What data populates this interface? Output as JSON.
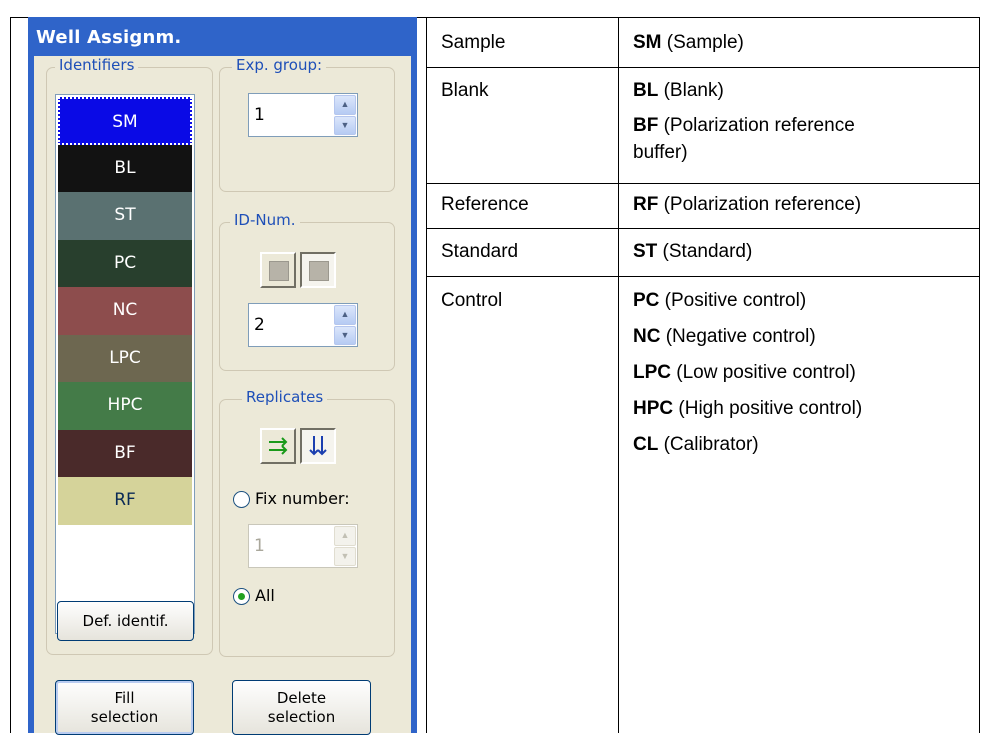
{
  "panel": {
    "title": "Well Assignm.",
    "identifiers": {
      "label": "Identifiers",
      "items": [
        {
          "code": "SM",
          "color": "#0a0ae6",
          "selected": true
        },
        {
          "code": "BL",
          "color": "#121212"
        },
        {
          "code": "ST",
          "color": "#5a7171"
        },
        {
          "code": "PC",
          "color": "#283f2d"
        },
        {
          "code": "NC",
          "color": "#8d4d4d"
        },
        {
          "code": "LPC",
          "color": "#6d6750"
        },
        {
          "code": "HPC",
          "color": "#447b48"
        },
        {
          "code": "BF",
          "color": "#4a2a2a"
        },
        {
          "code": "RF",
          "color": "#d5d39a",
          "text_color": "#0a2a56"
        }
      ],
      "def_button": "Def. identif."
    },
    "exp_group": {
      "label": "Exp. group:",
      "value": "1"
    },
    "id_num": {
      "label": "ID-Num.",
      "value": "2"
    },
    "replicates": {
      "label": "Replicates",
      "fix_label": "Fix number:",
      "fix_value": "1",
      "all_label": "All",
      "selected": "All"
    },
    "buttons": {
      "fill_line1": "Fill",
      "fill_line2": "selection",
      "delete_line1": "Delete",
      "delete_line2": "selection"
    }
  },
  "table": {
    "rows": [
      {
        "type": "Sample",
        "entries": [
          {
            "code": "SM",
            "desc": " (Sample)"
          }
        ]
      },
      {
        "type": "Blank",
        "entries": [
          {
            "code": "BL",
            "desc": " (Blank)"
          },
          {
            "code": "BF",
            "desc": " (Polarization reference",
            "desc2": "buffer)"
          }
        ]
      },
      {
        "type": "Reference",
        "entries": [
          {
            "code": "RF",
            "desc": " (Polarization reference)"
          }
        ]
      },
      {
        "type": "Standard",
        "entries": [
          {
            "code": "ST",
            "desc": " (Standard)"
          }
        ]
      },
      {
        "type": "Control",
        "entries": [
          {
            "code": "PC",
            "desc": " (Positive control)"
          },
          {
            "code": "NC",
            "desc": " (Negative control)"
          },
          {
            "code": "LPC",
            "desc": " (Low positive control)"
          },
          {
            "code": "HPC",
            "desc": " (High positive control)"
          },
          {
            "code": "CL",
            "desc": " (Calibrator)"
          }
        ]
      }
    ]
  }
}
